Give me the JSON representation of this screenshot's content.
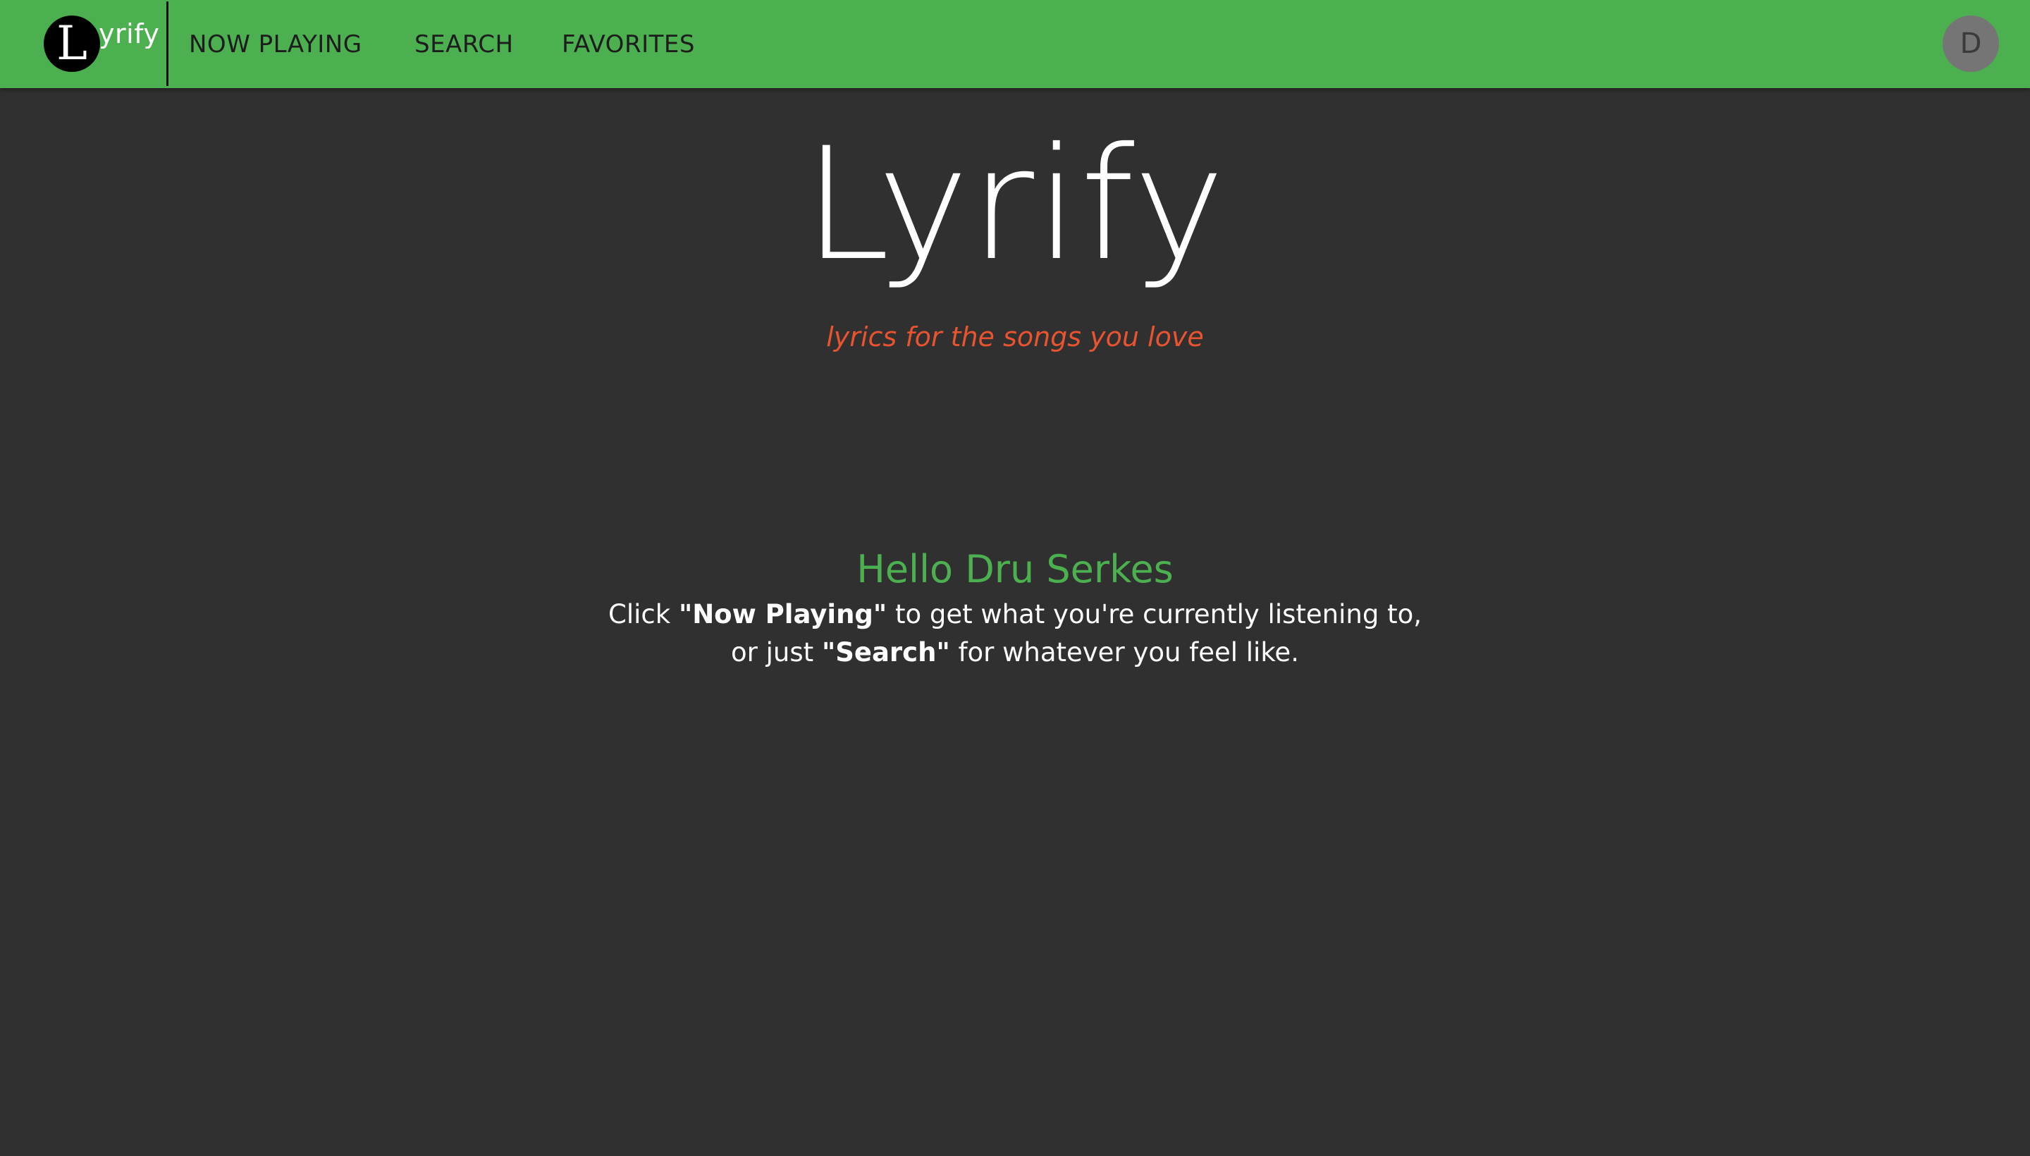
{
  "nav": {
    "logo_letter": "L",
    "logo_text": "yrify",
    "links": [
      "NOW PLAYING",
      "SEARCH",
      "FAVORITES"
    ],
    "avatar_initial": "D",
    "bg_color": "#4caf50"
  },
  "hero": {
    "title": "Lyrify",
    "tagline": "lyrics for the songs you love"
  },
  "welcome": {
    "greeting": "Hello Dru Serkes",
    "line1_pre": "Click ",
    "line1_bold": "\"Now Playing\"",
    "line1_post": " to get what you're currently listening to,",
    "line2_pre": "or just ",
    "line2_bold": "\"Search\"",
    "line2_post": " for whatever you feel like."
  },
  "colors": {
    "page_bg": "#303030",
    "accent_green": "#4caf50",
    "tagline_orange": "#e8542f"
  }
}
